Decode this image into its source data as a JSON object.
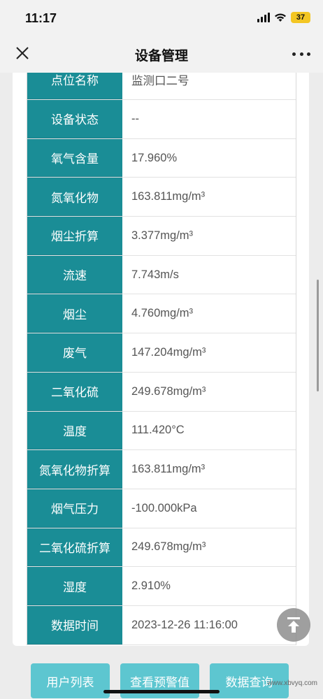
{
  "status_bar": {
    "time": "11:17",
    "battery": "37"
  },
  "nav": {
    "title": "设备管理"
  },
  "table": {
    "rows": [
      {
        "label": "点位名称",
        "value": "监测口二号"
      },
      {
        "label": "设备状态",
        "value": "--"
      },
      {
        "label": "氧气含量",
        "value": "17.960%"
      },
      {
        "label": "氮氧化物",
        "value": "163.811mg/m³"
      },
      {
        "label": "烟尘折算",
        "value": "3.377mg/m³"
      },
      {
        "label": "流速",
        "value": "7.743m/s"
      },
      {
        "label": "烟尘",
        "value": "4.760mg/m³"
      },
      {
        "label": "废气",
        "value": "147.204mg/m³"
      },
      {
        "label": "二氧化硫",
        "value": "249.678mg/m³"
      },
      {
        "label": "温度",
        "value": "111.420°C"
      },
      {
        "label": "氮氧化物折算",
        "value": "163.811mg/m³"
      },
      {
        "label": "烟气压力",
        "value": "-100.000kPa"
      },
      {
        "label": "二氧化硫折算",
        "value": "249.678mg/m³"
      },
      {
        "label": "湿度",
        "value": "2.910%"
      },
      {
        "label": "数据时间",
        "value": "2023-12-26 11:16:00"
      }
    ]
  },
  "buttons": {
    "user_list": "用户列表",
    "view_warning": "查看预警值",
    "data_query": "数据查询"
  },
  "watermark": "www.xbvyq.com",
  "colors": {
    "label_bg": "#1a8d96",
    "button_bg": "#5dc6d0"
  }
}
